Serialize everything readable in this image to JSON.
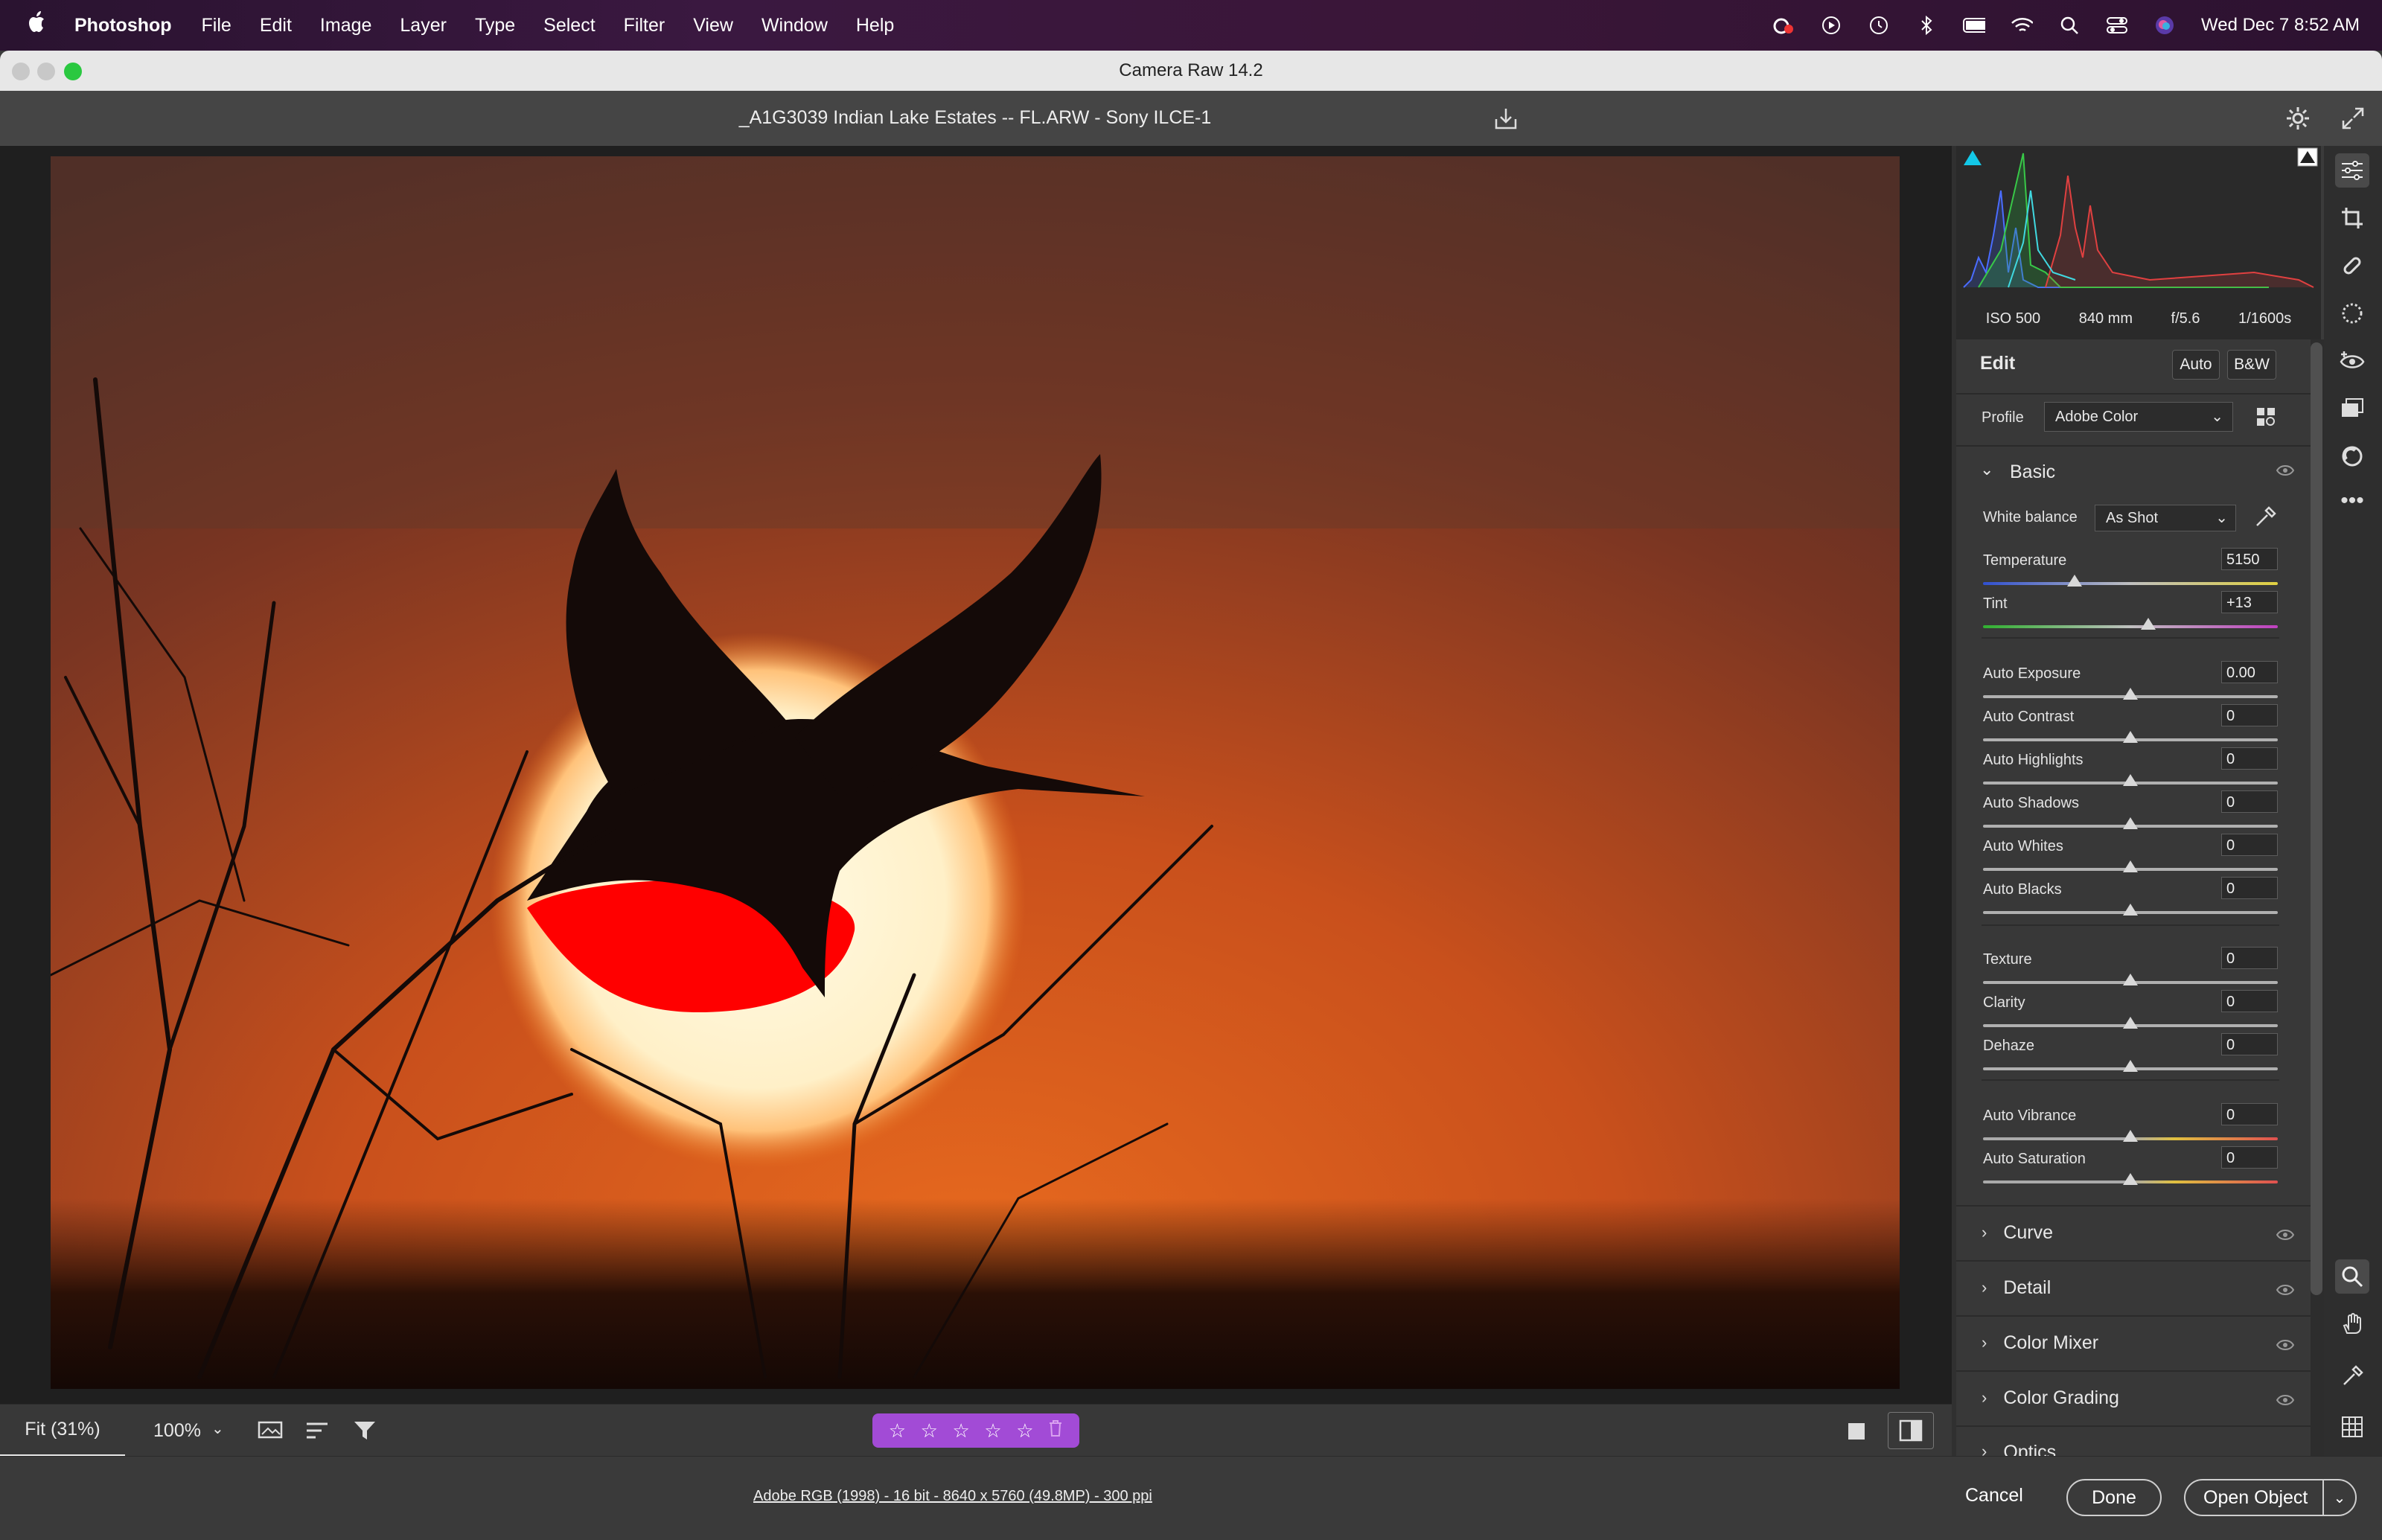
{
  "menubar": {
    "app_name": "Photoshop",
    "items": [
      "File",
      "Edit",
      "Image",
      "Layer",
      "Type",
      "Select",
      "Filter",
      "View",
      "Window",
      "Help"
    ],
    "clock": "Wed Dec 7  8:52 AM"
  },
  "window": {
    "title": "Camera Raw 14.2"
  },
  "header": {
    "filename": "_A1G3039 Indian Lake Estates -- FL.ARW  -  Sony ILCE-1"
  },
  "exif": {
    "iso": "ISO 500",
    "focal": "840 mm",
    "aperture": "f/5.6",
    "shutter": "1/1600s"
  },
  "edit": {
    "title": "Edit",
    "auto_label": "Auto",
    "bw_label": "B&W",
    "profile_label": "Profile",
    "profile_value": "Adobe Color",
    "basic_label": "Basic",
    "wb_label": "White balance",
    "wb_value": "As Shot"
  },
  "sliders": [
    {
      "label": "Temperature",
      "value": "5150",
      "pos": 0.31
    },
    {
      "label": "Tint",
      "value": "+13",
      "pos": 0.56
    },
    {
      "label": "Auto Exposure",
      "value": "0.00",
      "pos": 0.5
    },
    {
      "label": "Auto Contrast",
      "value": "0",
      "pos": 0.5
    },
    {
      "label": "Auto Highlights",
      "value": "0",
      "pos": 0.5
    },
    {
      "label": "Auto Shadows",
      "value": "0",
      "pos": 0.5
    },
    {
      "label": "Auto Whites",
      "value": "0",
      "pos": 0.5
    },
    {
      "label": "Auto Blacks",
      "value": "0",
      "pos": 0.5
    },
    {
      "label": "Texture",
      "value": "0",
      "pos": 0.5
    },
    {
      "label": "Clarity",
      "value": "0",
      "pos": 0.5
    },
    {
      "label": "Dehaze",
      "value": "0",
      "pos": 0.5
    },
    {
      "label": "Auto Vibrance",
      "value": "0",
      "pos": 0.5
    },
    {
      "label": "Auto Saturation",
      "value": "0",
      "pos": 0.5
    }
  ],
  "sections": [
    "Curve",
    "Detail",
    "Color Mixer",
    "Color Grading",
    "Optics"
  ],
  "viewbar": {
    "fit": "Fit (31%)",
    "zoom": "100%"
  },
  "rating": {
    "stars": 0,
    "max": 5
  },
  "status": {
    "workflow": "Adobe RGB (1998) - 16 bit - 8640 x 5760 (49.8MP) - 300 ppi"
  },
  "actions": {
    "cancel": "Cancel",
    "done": "Done",
    "open": "Open Object"
  },
  "colors": {
    "accent_purple": "#a24bd6",
    "clip_warning": "#ff0000",
    "shadow_clip": "#14c8e8"
  }
}
